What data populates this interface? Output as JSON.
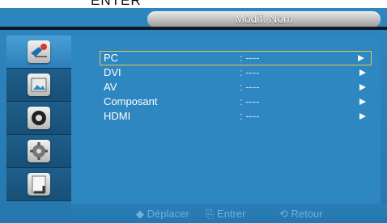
{
  "top_text": "ENTER",
  "title": "Modif. Nom",
  "sidebar": [
    {
      "icon": "input-settings-icon",
      "active": true
    },
    {
      "icon": "picture-icon",
      "active": false
    },
    {
      "icon": "sound-icon",
      "active": false
    },
    {
      "icon": "setup-gear-icon",
      "active": false
    },
    {
      "icon": "multiscreen-icon",
      "active": false
    }
  ],
  "rows": [
    {
      "label": "PC",
      "value": ": ----"
    },
    {
      "label": "DVI",
      "value": ": ----"
    },
    {
      "label": "AV",
      "value": ": ----"
    },
    {
      "label": "Composant",
      "value": ": ----"
    },
    {
      "label": "HDMI",
      "value": ": ----"
    }
  ],
  "footer": {
    "move_label": "Déplacer",
    "enter_label": "Entrer",
    "return_label": "Retour"
  }
}
